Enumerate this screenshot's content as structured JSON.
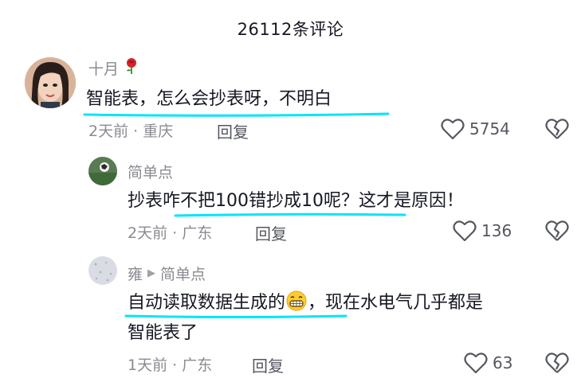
{
  "header": {
    "title": "26112条评论"
  },
  "comments": [
    {
      "username": "十月",
      "username_emoji": "rose-icon",
      "text": "智能表，怎么会抄表呀，不明白",
      "time": "2天前",
      "location": "重庆",
      "reply_label": "回复",
      "likes": "5754"
    },
    {
      "username": "简单点",
      "text": "抄表咋不把100错抄成10呢？这才是原因！",
      "time": "2天前",
      "location": "广东",
      "reply_label": "回复",
      "likes": "136"
    },
    {
      "username": "雍",
      "reply_to": "简单点",
      "text_part1": "自动读取数据生成的",
      "text_part2": "，现在水电气几乎都是",
      "text_line2": "智能表了",
      "time": "1天前",
      "location": "广东",
      "reply_label": "回复",
      "likes": "63"
    }
  ],
  "colors": {
    "highlight": "#00e5ff",
    "text": "#161823",
    "meta": "#8a8b91"
  }
}
